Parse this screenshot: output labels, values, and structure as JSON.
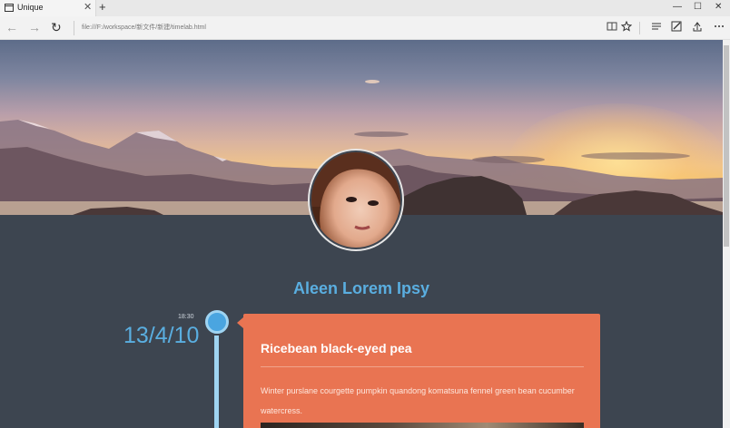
{
  "browser": {
    "tab_title": "Unique",
    "tab_close": "✕",
    "new_tab": "+",
    "window": {
      "minimize": "—",
      "maximize": "☐",
      "close": "✕"
    },
    "nav": {
      "back": "←",
      "forward": "→",
      "refresh": "↻"
    },
    "url": "file:///F:/workspace/新文件/新建/timelab.html",
    "toolbar_icons": [
      "reading-view-icon",
      "favorite-star-icon",
      "hub-icon",
      "web-note-icon",
      "share-icon",
      "more-icon"
    ]
  },
  "profile": {
    "name": "Aleen Lorem Ipsy"
  },
  "timeline": {
    "entries": [
      {
        "time": "18:30",
        "date": "13/4/10",
        "title": "Ricebean black-eyed pea",
        "text": "Winter purslane courgette pumpkin quandong komatsuna fennel green bean cucumber watercress."
      }
    ]
  },
  "colors": {
    "accent": "#5aaee0",
    "card": "#e97452",
    "background": "#3d4550"
  }
}
